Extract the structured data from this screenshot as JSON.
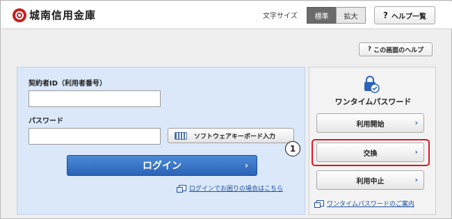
{
  "header": {
    "bank_name": "城南信用金庫",
    "font_size_label": "文字サイズ",
    "font_size_options": [
      "標準",
      "拡大"
    ],
    "help_button": "ヘルプ一覧",
    "help_icon_glyph": "?"
  },
  "screen_help": {
    "label": "この画面のヘルプ",
    "icon_glyph": "?"
  },
  "login": {
    "contract_id_label": "契約者ID（利用者番号）",
    "contract_id_value": "",
    "password_label": "パスワード",
    "password_value": "",
    "keyboard_button": "ソフトウェアキーボード入力",
    "login_button": "ログイン",
    "login_chevron": "›",
    "trouble_link": "ログインでお困りの場合はこちら"
  },
  "otp": {
    "title": "ワンタイムパスワード",
    "buttons": [
      "利用開始",
      "交換",
      "利用中止"
    ],
    "chevron": "›",
    "guide_link": "ワンタイムパスワードのご案内",
    "callout_number": "1",
    "highlight_color": "#e0141e"
  },
  "colors": {
    "login_button": "#2c63b6",
    "login_panel": "#dbe8f9",
    "link": "#1a4fa0",
    "logo_mark": "#c81e1e"
  }
}
